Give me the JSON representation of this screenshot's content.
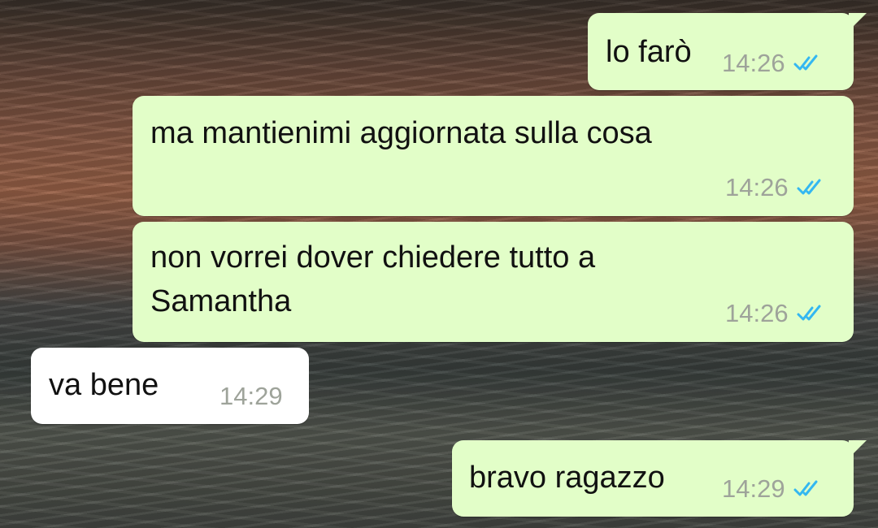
{
  "messages": [
    {
      "direction": "out",
      "text": "lo farò",
      "time": "14:26",
      "status_icon": "double-check-read-icon"
    },
    {
      "direction": "out",
      "text": "ma mantienimi aggiornata sulla cosa",
      "time": "14:26",
      "status_icon": "double-check-read-icon"
    },
    {
      "direction": "out",
      "text_lines": [
        "non vorrei dover chiedere tutto a",
        "Samantha"
      ],
      "time": "14:26",
      "status_icon": "double-check-read-icon"
    },
    {
      "direction": "in",
      "text": "va bene",
      "time": "14:29"
    },
    {
      "direction": "out",
      "text": "bravo ragazzo",
      "time": "14:29",
      "status_icon": "double-check-read-icon"
    }
  ],
  "colors": {
    "outgoing_bubble": "#e2fec8",
    "incoming_bubble": "#ffffff",
    "read_ticks": "#34b7f1",
    "timestamp": "#9ea39a"
  }
}
